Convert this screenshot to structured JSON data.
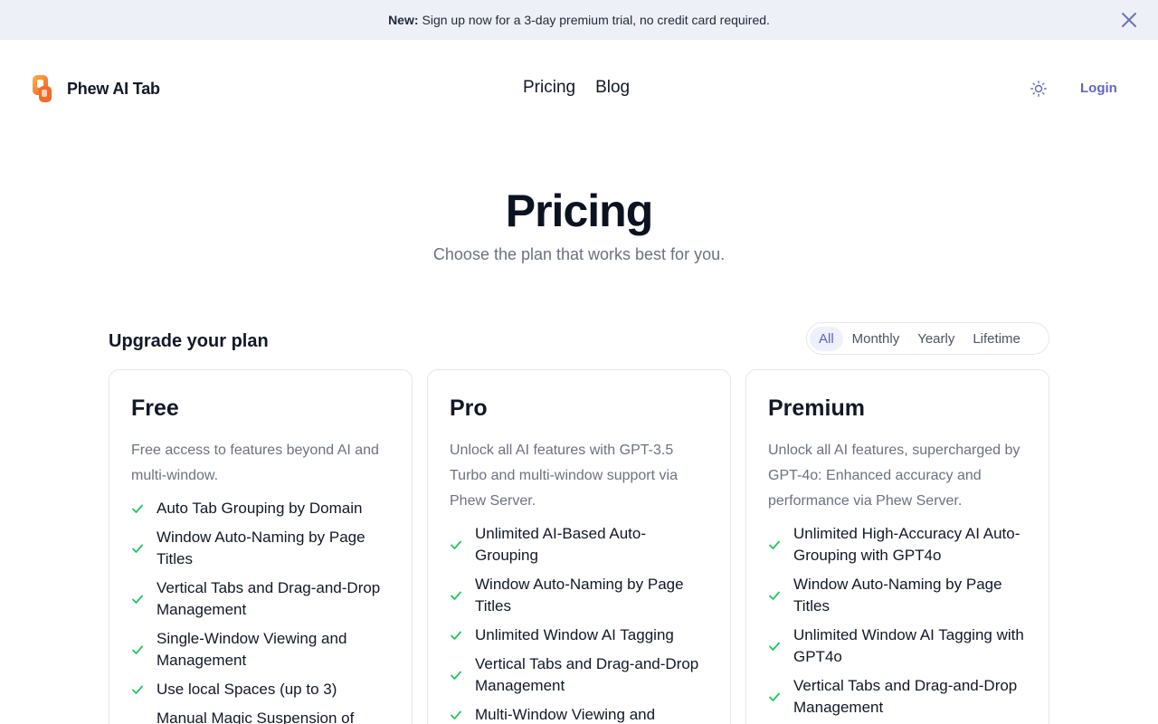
{
  "banner": {
    "strong": "New:",
    "text": "Sign up now for a 3-day premium trial, no credit card required."
  },
  "header": {
    "brand": "Phew AI Tab",
    "nav": [
      "Pricing",
      "Blog"
    ],
    "login": "Login"
  },
  "hero": {
    "title": "Pricing",
    "subtitle": "Choose the plan that works best for you."
  },
  "plans_section": {
    "heading": "Upgrade your plan",
    "tabs": [
      "All",
      "Monthly",
      "Yearly",
      "Lifetime"
    ],
    "active_tab": "All"
  },
  "colors": {
    "accent": "#5b5fc7",
    "check": "#22c55e",
    "banner_bg": "#eef0f8"
  },
  "plans": [
    {
      "name": "Free",
      "description": "Free access to features beyond AI and multi-window.",
      "features": [
        "Auto Tab Grouping by Domain",
        "Window Auto-Naming by Page Titles",
        "Vertical Tabs and Drag-and-Drop Management",
        "Single-Window Viewing and Management",
        "Use local Spaces (up to 3)",
        "Manual Magic Suspension of Tabs"
      ]
    },
    {
      "name": "Pro",
      "description": "Unlock all AI features with GPT-3.5 Turbo and multi-window support via Phew Server.",
      "features": [
        "Unlimited AI-Based Auto-Grouping",
        "Window Auto-Naming by Page Titles",
        "Unlimited Window AI Tagging",
        "Vertical Tabs and Drag-and-Drop Management",
        "Multi-Window Viewing and"
      ]
    },
    {
      "name": "Premium",
      "description": "Unlock all AI features, supercharged by GPT-4o: Enhanced accuracy and performance via Phew Server.",
      "features": [
        "Unlimited High-Accuracy AI Auto-Grouping with GPT4o",
        "Window Auto-Naming by Page Titles",
        "Unlimited Window AI Tagging with GPT4o",
        "Vertical Tabs and Drag-and-Drop Management"
      ]
    }
  ]
}
